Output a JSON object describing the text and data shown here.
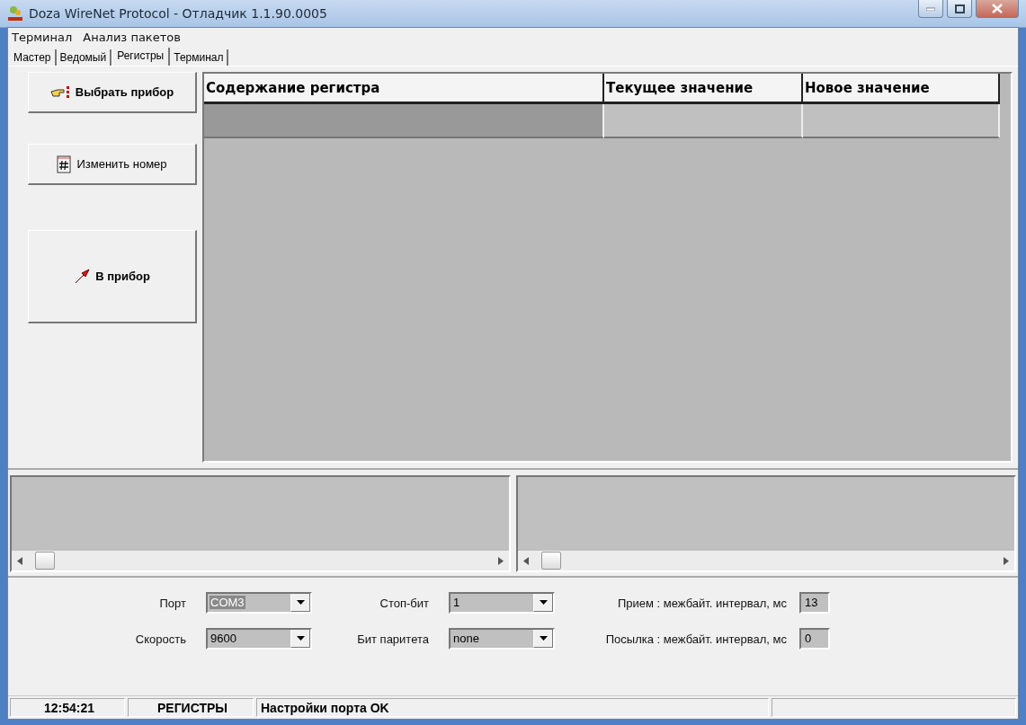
{
  "window": {
    "title": "Doza WireNet Protocol - Отладчик 1.1.90.0005"
  },
  "menu": [
    "Терминал",
    "Анализ пакетов"
  ],
  "tabs": [
    {
      "label": "Мастер",
      "selected": false
    },
    {
      "label": "Ведомый",
      "selected": false
    },
    {
      "label": "Регистры",
      "selected": true
    },
    {
      "label": "Терминал",
      "selected": false
    }
  ],
  "buttons": [
    {
      "label": "Выбрать прибор",
      "kind": "select"
    },
    {
      "label": "Изменить номер",
      "kind": "number"
    },
    {
      "label": "В прибор",
      "kind": "send"
    }
  ],
  "table": {
    "columns": [
      "Содержание регистра",
      "Текущее значение",
      "Новое значение"
    ],
    "rows": [
      {
        "selected": true
      }
    ]
  },
  "settings": [
    {
      "label": "Порт",
      "value": "COM3",
      "kind": "combo",
      "highlighted": true
    },
    {
      "label": "Стоп-бит",
      "value": "1",
      "kind": "combo"
    },
    {
      "label": "Прием : межбайт. интервал, мс",
      "value": "13",
      "kind": "edit"
    },
    {
      "label": "Скорость",
      "value": "9600",
      "kind": "combo"
    },
    {
      "label": "Бит паритета",
      "value": "none",
      "kind": "combo"
    },
    {
      "label": "Посылка : межбайт. интервал, мс",
      "value": "0",
      "kind": "edit"
    }
  ],
  "status_bar": [
    "12:54:21",
    "РЕГИСТРЫ",
    "Настройки порта OK"
  ]
}
